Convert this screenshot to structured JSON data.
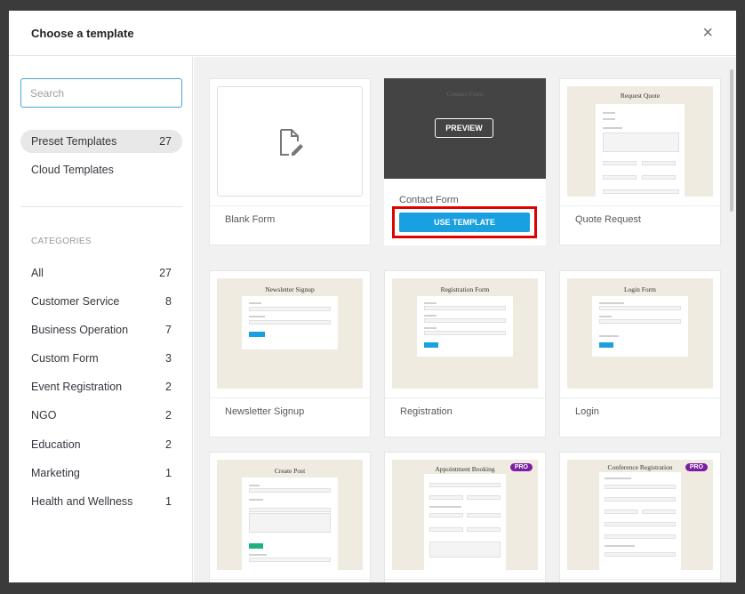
{
  "dialog": {
    "title": "Choose a template",
    "close_symbol": "×"
  },
  "sidebar": {
    "search_placeholder": "Search",
    "sources": [
      {
        "label": "Preset Templates",
        "count": "27"
      },
      {
        "label": "Cloud Templates",
        "count": ""
      }
    ],
    "categories_heading": "CATEGORIES",
    "categories": [
      {
        "label": "All",
        "count": "27"
      },
      {
        "label": "Customer Service",
        "count": "8"
      },
      {
        "label": "Business Operation",
        "count": "7"
      },
      {
        "label": "Custom Form",
        "count": "3"
      },
      {
        "label": "Event Registration",
        "count": "2"
      },
      {
        "label": "NGO",
        "count": "2"
      },
      {
        "label": "Education",
        "count": "2"
      },
      {
        "label": "Marketing",
        "count": "1"
      },
      {
        "label": "Health and Wellness",
        "count": "1"
      }
    ]
  },
  "templates": [
    {
      "label": "Blank Form",
      "thumb_title": "",
      "icon": "file-edit-icon"
    },
    {
      "label": "Contact Form",
      "thumb_title": "Contact Form",
      "preview_label": "PREVIEW",
      "use_label": "USE TEMPLATE"
    },
    {
      "label": "Quote Request",
      "thumb_title": "Request Quote"
    },
    {
      "label": "Newsletter Signup",
      "thumb_title": "Newsletter Signup"
    },
    {
      "label": "Registration",
      "thumb_title": "Registration Form"
    },
    {
      "label": "Login",
      "thumb_title": "Login Form"
    },
    {
      "label": "",
      "thumb_title": "Create Post"
    },
    {
      "label": "",
      "thumb_title": "Appointment Booking",
      "badge": "PRO"
    },
    {
      "label": "",
      "thumb_title": "Conference Registration",
      "badge": "PRO"
    }
  ],
  "colors": {
    "accent": "#1aa0e0",
    "highlight": "#e00000",
    "pro_badge": "#7a1fa2",
    "thumb_bg": "#efebe0"
  }
}
